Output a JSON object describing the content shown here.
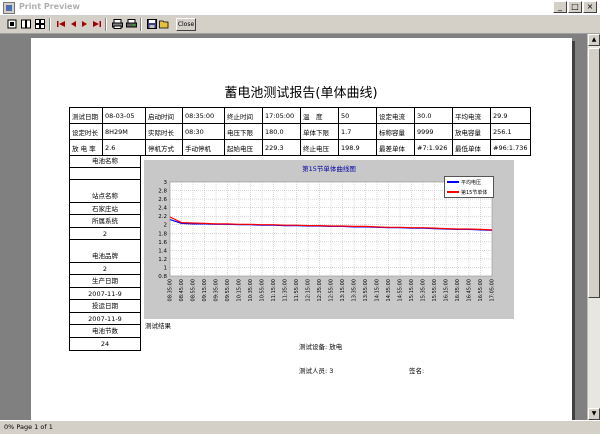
{
  "window": {
    "title": "Print Preview"
  },
  "toolbar": {
    "close_label": "Close",
    "icons": [
      "view-onepage-icon",
      "view-twopage-icon",
      "view-multipage-icon",
      "first-page-icon",
      "prev-page-icon",
      "next-page-icon",
      "last-page-icon",
      "print-icon",
      "print-setup-icon",
      "save-icon",
      "open-icon"
    ]
  },
  "report": {
    "title": "蓄电池测试报告(单体曲线)",
    "info_rows": [
      [
        "测试日期",
        "08-03-05",
        "启动时间",
        "08:35:00",
        "终止时间",
        "17:05:00",
        "温　度",
        "50",
        "设定电流",
        "30.0",
        "平均电流",
        "29.9"
      ],
      [
        "设定时长",
        "8H29M",
        "实际时长",
        "08:30",
        "电压下限",
        "180.0",
        "单体下限",
        "1.7",
        "标称容量",
        "9999",
        "放电容量",
        "256.1"
      ],
      [
        "放 电 率",
        "2.6",
        "停机方式",
        "手动停机",
        "起始电压",
        "229.3",
        "终止电压",
        "198.9",
        "最差单体",
        "#7:1.926",
        "最低单体",
        "#96:1.736"
      ]
    ],
    "side_items": [
      {
        "label": "电池名称",
        "value": ""
      },
      {
        "label": "站点名称",
        "value": "石家庄站"
      },
      {
        "label": "所属系统",
        "value": "2"
      },
      {
        "label": "电池品牌",
        "value": "2"
      },
      {
        "label": "生产日期",
        "value": "2007-11-9"
      },
      {
        "label": "投运日期",
        "value": "2007-11-9"
      },
      {
        "label": "电池节数",
        "value": "24"
      }
    ],
    "section_label": "测试结果",
    "device_label": "测试设备:",
    "device_value": "放电",
    "tester_label": "测试人员:",
    "tester_value": "3",
    "sign_label": "签名:"
  },
  "chart_data": {
    "type": "line",
    "title": "第15节单体曲线图",
    "ylim": [
      0.8,
      3.0
    ],
    "yticks": [
      0.8,
      1.0,
      1.2,
      1.4,
      1.6,
      1.8,
      2.0,
      2.2,
      2.4,
      2.6,
      2.8,
      3.0
    ],
    "x": [
      "08:35:00",
      "08:45:00",
      "08:55:00",
      "09:15:00",
      "09:35:00",
      "09:55:00",
      "10:15:00",
      "10:35:00",
      "10:55:00",
      "11:15:00",
      "11:35:00",
      "11:55:00",
      "12:15:00",
      "12:35:00",
      "12:55:00",
      "13:15:00",
      "13:35:00",
      "13:55:00",
      "14:15:00",
      "14:35:00",
      "14:55:00",
      "15:15:00",
      "15:35:00",
      "15:55:00",
      "16:15:00",
      "16:35:00",
      "16:45:00",
      "16:55:00",
      "17:05:00"
    ],
    "series": [
      {
        "name": "平均电压",
        "color": "#0000ff",
        "values": [
          2.12,
          2.03,
          2.02,
          2.02,
          2.01,
          2.01,
          2.0,
          2.0,
          1.99,
          1.99,
          1.98,
          1.98,
          1.97,
          1.97,
          1.96,
          1.96,
          1.95,
          1.95,
          1.94,
          1.93,
          1.93,
          1.92,
          1.92,
          1.91,
          1.9,
          1.89,
          1.89,
          1.88,
          1.87
        ]
      },
      {
        "name": "第15节单体",
        "color": "#ff0000",
        "values": [
          2.18,
          2.05,
          2.04,
          2.03,
          2.02,
          2.02,
          2.01,
          2.01,
          2.0,
          2.0,
          1.99,
          1.99,
          1.98,
          1.98,
          1.97,
          1.97,
          1.96,
          1.96,
          1.95,
          1.94,
          1.94,
          1.93,
          1.93,
          1.92,
          1.91,
          1.9,
          1.9,
          1.89,
          1.88
        ]
      }
    ],
    "grid": true,
    "legend_position": "top-right"
  },
  "status": {
    "text": "0% Page 1 of 1"
  }
}
